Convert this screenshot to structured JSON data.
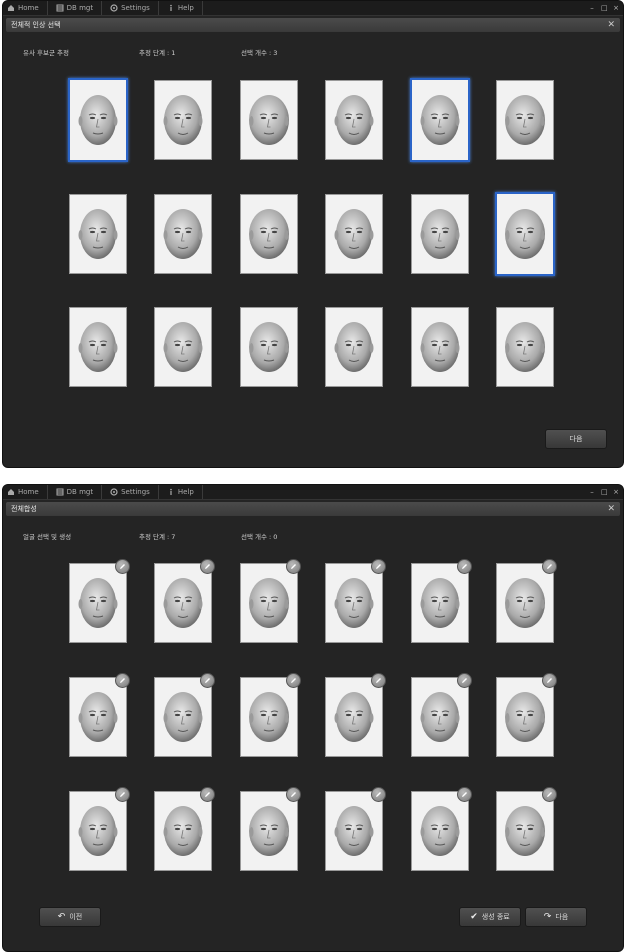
{
  "menu": {
    "items": [
      {
        "label": "Home",
        "icon": "home-icon"
      },
      {
        "label": "DB mgt",
        "icon": "database-icon"
      },
      {
        "label": "Settings",
        "icon": "gear-icon"
      },
      {
        "label": "Help",
        "icon": "info-icon"
      }
    ],
    "controls": [
      "–",
      "□",
      "×"
    ]
  },
  "window1": {
    "title": "전체적 인상 선택",
    "status": {
      "mode": "유사 후보군 추정",
      "step_label": "추정 단계 : 1",
      "count_label": "선택 개수 : 3"
    },
    "selected_cards": [
      0,
      4,
      11
    ],
    "next_button": "다음"
  },
  "window2": {
    "title": "전체합성",
    "status": {
      "mode": "얼굴 선택 및 생성",
      "step_label": "추정 단계 : 7",
      "count_label": "선택 개수 : 0"
    },
    "prev_button": "이전",
    "finish_button": "생성 종료",
    "next_button": "다음"
  },
  "colors": {
    "background": "#242424",
    "selection": "#2a64c8",
    "card": "#f2f2f2"
  }
}
